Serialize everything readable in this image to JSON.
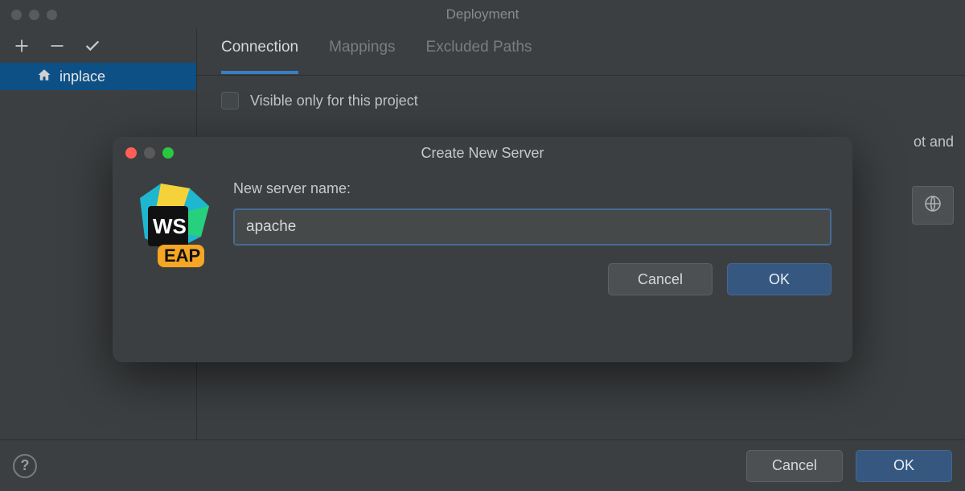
{
  "window": {
    "title": "Deployment"
  },
  "sidebar": {
    "items": [
      {
        "label": "inplace"
      }
    ]
  },
  "tabs": [
    {
      "label": "Connection",
      "active": true
    },
    {
      "label": "Mappings",
      "active": false
    },
    {
      "label": "Excluded Paths",
      "active": false
    }
  ],
  "checkbox": {
    "label": "Visible only for this project",
    "checked": false
  },
  "partial_text": "ot and",
  "footer": {
    "cancel": "Cancel",
    "ok": "OK",
    "help": "?"
  },
  "dialog": {
    "title": "Create New Server",
    "field_label": "New server name:",
    "value": "apache",
    "cancel": "Cancel",
    "ok": "OK",
    "app_badge_top": "WS",
    "app_badge_bottom": "EAP"
  }
}
